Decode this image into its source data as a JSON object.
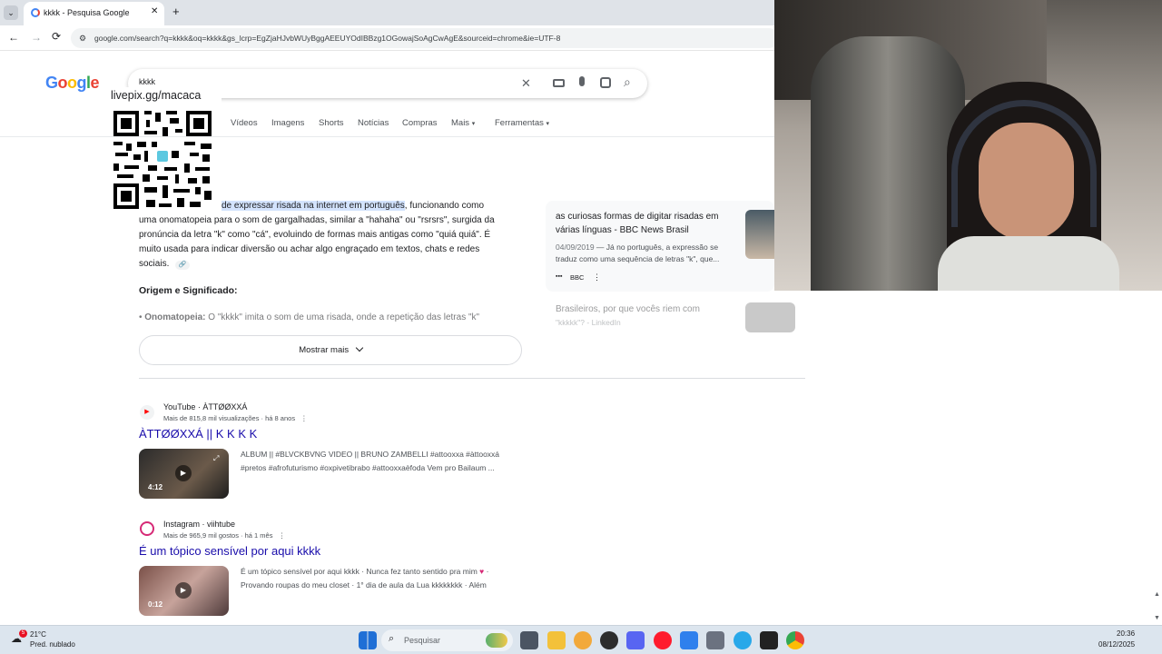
{
  "browser": {
    "tab_title": "kkkk - Pesquisa Google",
    "new_tab": "+",
    "url": "google.com/search?q=kkkk&oq=kkkk&gs_lcrp=EgZjaHJvbWUyBggAEEUYOdIBBzg1OGowajSoAgCwAgE&sourceid=chrome&ie=UTF-8"
  },
  "google": {
    "logo": "Google",
    "query": "kkkk",
    "tabs": [
      "Vídeos",
      "Imagens",
      "Shorts",
      "Notícias",
      "Compras",
      "Mais",
      "Ferramentas"
    ]
  },
  "overlay": {
    "qr_label": "livepix.gg/macaca"
  },
  "ai_answer": {
    "highlight": "de expressar risada na internet em português",
    "text_tail": ", funcionando como",
    "line2": "uma onomatopeia para o som de gargalhadas, similar a \"hahaha\" ou \"rsrsrs\", surgida da",
    "line3": "pronúncia da letra \"k\" como \"cá\", evoluindo de formas mais antigas como \"quiá quiá\". É",
    "line4": "muito usada para indicar diversão ou achar algo engraçado em textos, chats e redes",
    "line5": "sociais.",
    "section_heading": "Origem e Significado:",
    "bullet_bold": "Onomatopeia:",
    "bullet_text": " O \"kkkk\" imita o som de uma risada, onde a repetição das letras \"k\"",
    "show_more": "Mostrar mais"
  },
  "side_cards": [
    {
      "title": "as curiosas formas de digitar risadas em várias línguas - BBC News Brasil",
      "date": "04/09/2019",
      "snippet": " — Já no português, a expressão se traduz como uma sequência de letras \"k\", que...",
      "source": "BBC"
    },
    {
      "title": "Brasileiros, por que vocês riem com",
      "snippet": "\"kkkkk\"? - LinkedIn"
    }
  ],
  "results": [
    {
      "platform": "YouTube",
      "author": "ÀTTØØXXÁ",
      "meta": "Mais de 815,8 mil visualizações · há 8 anos",
      "title": "ÀTTØØXXÁ || K K K K",
      "duration": "4:12",
      "desc1": "ALBUM || #BLVCKBVNG VIDEO || BRUNO ZAMBELLI #attooxxa #àttooxxá",
      "desc2": "#pretos #afrofuturismo #oxpivetibrabo #attooxxaèfoda Vem pro Bailaum ..."
    },
    {
      "platform": "Instagram",
      "author": "viihtube",
      "meta": "Mais de 965,9 mil gostos · há 1 mês",
      "title": "É um tópico sensível por aqui kkkk",
      "duration": "0:12",
      "desc1": "É um tópico sensível por aqui kkkk · Nunca fez tanto sentido pra mim",
      "desc2": "Provando roupas do meu closet · 1° dia de aula da Lua kkkkkkkk · Além"
    }
  ],
  "taskbar": {
    "weather_temp": "21°C",
    "weather_desc": "Pred. nublado",
    "search_label": "Pesquisar",
    "time": "20:36",
    "date": "08/12/2025",
    "badge": "5"
  },
  "colors": {
    "link": "#1a0dab",
    "highlight": "#d3e3fd",
    "youtube": "#ff0000",
    "instagram": "#d62976"
  }
}
